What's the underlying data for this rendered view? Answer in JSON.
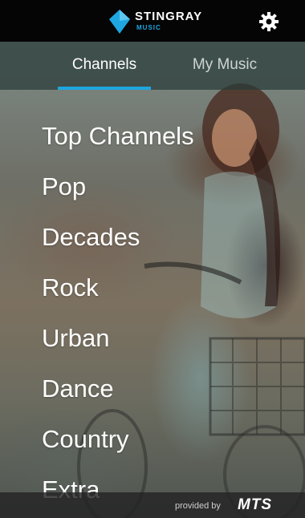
{
  "header": {
    "brand": "STINGRAY",
    "brand_sub": "MUSIC",
    "settings_icon": "gear-icon",
    "colors": {
      "bar": "#050505",
      "accent": "#1ea6e0"
    }
  },
  "tabs": [
    {
      "label": "Channels",
      "active": true
    },
    {
      "label": "My Music",
      "active": false
    }
  ],
  "channels": [
    {
      "label": "Top Channels"
    },
    {
      "label": "Pop"
    },
    {
      "label": "Decades"
    },
    {
      "label": "Rock"
    },
    {
      "label": "Urban"
    },
    {
      "label": "Dance"
    },
    {
      "label": "Country"
    },
    {
      "label": "Extra"
    }
  ],
  "footer": {
    "provided_by": "provided by",
    "provider": "MTS"
  }
}
